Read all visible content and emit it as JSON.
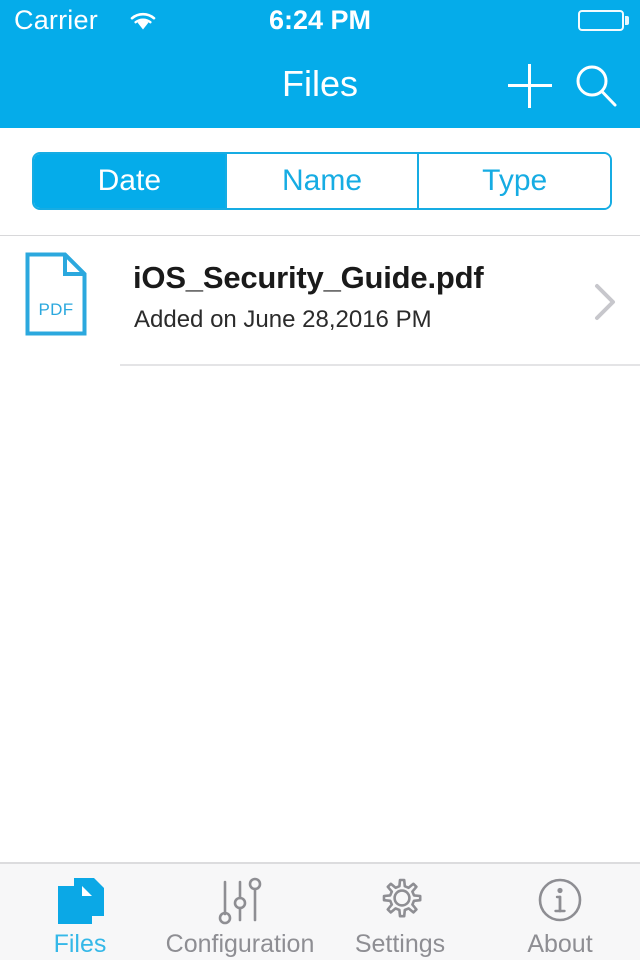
{
  "status_bar": {
    "carrier": "Carrier",
    "wifi_icon": "wifi-icon",
    "time": "6:24 PM",
    "battery_icon": "battery-icon"
  },
  "nav_bar": {
    "title": "Files",
    "add_icon": "plus-icon",
    "search_icon": "search-icon",
    "background_color": "#05ACEA"
  },
  "segmented_control": {
    "segments": [
      {
        "label": "Date",
        "selected": true
      },
      {
        "label": "Name",
        "selected": false
      },
      {
        "label": "Type",
        "selected": false
      }
    ],
    "accent_color": "#16ACE3"
  },
  "file_list": {
    "rows": [
      {
        "icon": "pdf-file-icon",
        "icon_label": "PDF",
        "title": "iOS_Security_Guide.pdf",
        "subtitle": "Added on June 28,2016 PM",
        "disclosure_icon": "chevron-right-icon"
      }
    ]
  },
  "tab_bar": {
    "tabs": [
      {
        "label": "Files",
        "icon": "documents-icon",
        "active": true
      },
      {
        "label": "Configuration",
        "icon": "sliders-icon",
        "active": false
      },
      {
        "label": "Settings",
        "icon": "gear-icon",
        "active": false
      },
      {
        "label": "About",
        "icon": "info-circle-icon",
        "active": false
      }
    ],
    "active_color": "#35B8E8",
    "inactive_color": "#8E8E93"
  }
}
